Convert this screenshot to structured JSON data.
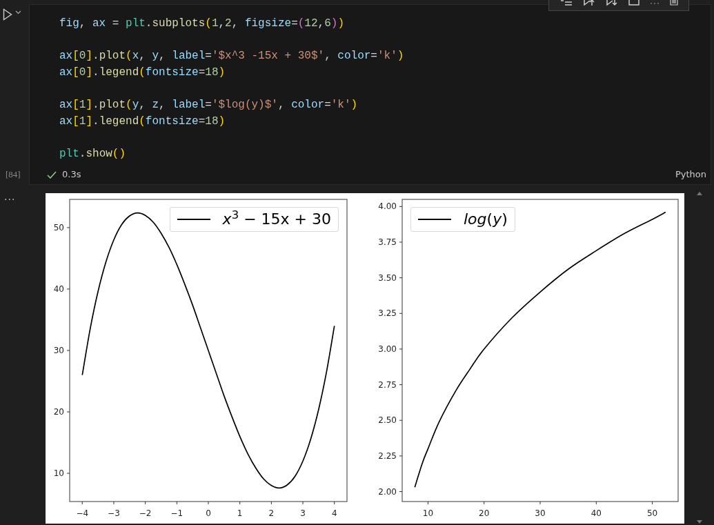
{
  "cell": {
    "execution_count": "[84]",
    "status": {
      "succeeded": true,
      "duration": "0.3s"
    },
    "language": "Python",
    "code_blocks": [
      {
        "lines": [
          [
            {
              "text": "fig",
              "kind": "var"
            },
            {
              "text": ", ",
              "kind": "punct"
            },
            {
              "text": "ax",
              "kind": "var"
            },
            {
              "text": " = ",
              "kind": "punct"
            },
            {
              "text": "plt",
              "kind": "module"
            },
            {
              "text": ".",
              "kind": "punct"
            },
            {
              "text": "subplots",
              "kind": "func"
            },
            {
              "text": "(",
              "kind": "bracket1"
            },
            {
              "text": "1",
              "kind": "num"
            },
            {
              "text": ",",
              "kind": "punct"
            },
            {
              "text": "2",
              "kind": "num"
            },
            {
              "text": ", ",
              "kind": "punct"
            },
            {
              "text": "figsize",
              "kind": "var"
            },
            {
              "text": "=",
              "kind": "punct"
            },
            {
              "text": "(",
              "kind": "bracket2"
            },
            {
              "text": "12",
              "kind": "num"
            },
            {
              "text": ",",
              "kind": "punct"
            },
            {
              "text": "6",
              "kind": "num"
            },
            {
              "text": ")",
              "kind": "bracket2"
            },
            {
              "text": ")",
              "kind": "bracket1"
            }
          ]
        ]
      },
      {
        "lines": [
          [
            {
              "text": "ax",
              "kind": "var"
            },
            {
              "text": "[",
              "kind": "bracket1"
            },
            {
              "text": "0",
              "kind": "num"
            },
            {
              "text": "]",
              "kind": "bracket1"
            },
            {
              "text": ".",
              "kind": "punct"
            },
            {
              "text": "plot",
              "kind": "func"
            },
            {
              "text": "(",
              "kind": "bracket1"
            },
            {
              "text": "x",
              "kind": "var"
            },
            {
              "text": ", ",
              "kind": "punct"
            },
            {
              "text": "y",
              "kind": "var"
            },
            {
              "text": ", ",
              "kind": "punct"
            },
            {
              "text": "label",
              "kind": "var"
            },
            {
              "text": "=",
              "kind": "punct"
            },
            {
              "text": "'$x^3 -15x + 30$'",
              "kind": "str"
            },
            {
              "text": ", ",
              "kind": "punct"
            },
            {
              "text": "color",
              "kind": "var"
            },
            {
              "text": "=",
              "kind": "punct"
            },
            {
              "text": "'k'",
              "kind": "str"
            },
            {
              "text": ")",
              "kind": "bracket1"
            }
          ],
          [
            {
              "text": "ax",
              "kind": "var"
            },
            {
              "text": "[",
              "kind": "bracket1"
            },
            {
              "text": "0",
              "kind": "num"
            },
            {
              "text": "]",
              "kind": "bracket1"
            },
            {
              "text": ".",
              "kind": "punct"
            },
            {
              "text": "legend",
              "kind": "func"
            },
            {
              "text": "(",
              "kind": "bracket1"
            },
            {
              "text": "fontsize",
              "kind": "var"
            },
            {
              "text": "=",
              "kind": "punct"
            },
            {
              "text": "18",
              "kind": "num"
            },
            {
              "text": ")",
              "kind": "bracket1"
            }
          ]
        ]
      },
      {
        "lines": [
          [
            {
              "text": "ax",
              "kind": "var"
            },
            {
              "text": "[",
              "kind": "bracket1"
            },
            {
              "text": "1",
              "kind": "num"
            },
            {
              "text": "]",
              "kind": "bracket1"
            },
            {
              "text": ".",
              "kind": "punct"
            },
            {
              "text": "plot",
              "kind": "func"
            },
            {
              "text": "(",
              "kind": "bracket1"
            },
            {
              "text": "y",
              "kind": "var"
            },
            {
              "text": ", ",
              "kind": "punct"
            },
            {
              "text": "z",
              "kind": "var"
            },
            {
              "text": ", ",
              "kind": "punct"
            },
            {
              "text": "label",
              "kind": "var"
            },
            {
              "text": "=",
              "kind": "punct"
            },
            {
              "text": "'$log(y)$'",
              "kind": "str"
            },
            {
              "text": ", ",
              "kind": "punct"
            },
            {
              "text": "color",
              "kind": "var"
            },
            {
              "text": "=",
              "kind": "punct"
            },
            {
              "text": "'k'",
              "kind": "str"
            },
            {
              "text": ")",
              "kind": "bracket1"
            }
          ],
          [
            {
              "text": "ax",
              "kind": "var"
            },
            {
              "text": "[",
              "kind": "bracket1"
            },
            {
              "text": "1",
              "kind": "num"
            },
            {
              "text": "]",
              "kind": "bracket1"
            },
            {
              "text": ".",
              "kind": "punct"
            },
            {
              "text": "legend",
              "kind": "func"
            },
            {
              "text": "(",
              "kind": "bracket1"
            },
            {
              "text": "fontsize",
              "kind": "var"
            },
            {
              "text": "=",
              "kind": "punct"
            },
            {
              "text": "18",
              "kind": "num"
            },
            {
              "text": ")",
              "kind": "bracket1"
            }
          ]
        ]
      },
      {
        "lines": [
          [
            {
              "text": "plt",
              "kind": "module"
            },
            {
              "text": ".",
              "kind": "punct"
            },
            {
              "text": "show",
              "kind": "func"
            },
            {
              "text": "(",
              "kind": "bracket1"
            },
            {
              "text": ")",
              "kind": "bracket1"
            }
          ]
        ]
      }
    ]
  },
  "output": {
    "more": "...",
    "figures": [
      {
        "chart_data": {
          "type": "line",
          "x": [
            -4,
            -3.75,
            -3.5,
            -3.25,
            -3,
            -2.75,
            -2.5,
            -2.25,
            -2,
            -1.75,
            -1.5,
            -1.25,
            -1,
            -0.75,
            -0.5,
            -0.25,
            0,
            0.25,
            0.5,
            0.75,
            1,
            1.25,
            1.5,
            1.75,
            2,
            2.25,
            2.5,
            2.75,
            3,
            3.25,
            3.5,
            3.75,
            4
          ],
          "series": [
            {
              "name": "*x*$^{3}$ − 15x + 30",
              "color": "#000000",
              "values": [
                26,
                33.5,
                39.6,
                44.4,
                48,
                50.5,
                51.9,
                52.4,
                52,
                50.9,
                49.1,
                46.8,
                44,
                40.8,
                37.4,
                33.7,
                30,
                26.3,
                22.6,
                19.2,
                16,
                13.2,
                10.9,
                9.1,
                8,
                7.6,
                8.1,
                9.5,
                12,
                15.6,
                20.4,
                26.5,
                34
              ]
            }
          ],
          "xlim": [
            -4.4,
            4.4
          ],
          "ylim": [
            5.4,
            54.6
          ],
          "xticks": [
            {
              "value": -4,
              "label": "−4"
            },
            {
              "value": -3,
              "label": "−3"
            },
            {
              "value": -2,
              "label": "−2"
            },
            {
              "value": -1,
              "label": "−1"
            },
            {
              "value": 0,
              "label": "0"
            },
            {
              "value": 1,
              "label": "1"
            },
            {
              "value": 2,
              "label": "2"
            },
            {
              "value": 3,
              "label": "3"
            },
            {
              "value": 4,
              "label": "4"
            }
          ],
          "yticks": [
            {
              "value": 10,
              "label": "10"
            },
            {
              "value": 20,
              "label": "20"
            },
            {
              "value": 30,
              "label": "30"
            },
            {
              "value": 40,
              "label": "40"
            },
            {
              "value": 50,
              "label": "50"
            }
          ]
        }
      },
      {
        "chart_data": {
          "type": "line",
          "x": [
            7.64,
            9,
            10,
            12,
            15,
            17.5,
            20,
            25,
            30,
            35,
            40,
            45,
            50,
            52.36
          ],
          "series": [
            {
              "name": "*log*(*y*)",
              "color": "#000000",
              "values": [
                2.03,
                2.2,
                2.3,
                2.49,
                2.71,
                2.86,
                3,
                3.22,
                3.4,
                3.56,
                3.69,
                3.81,
                3.91,
                3.96
              ]
            }
          ],
          "xlim": [
            5.4,
            54.6
          ],
          "ylim": [
            1.93,
            4.05
          ],
          "xticks": [
            {
              "value": 10,
              "label": "10"
            },
            {
              "value": 20,
              "label": "20"
            },
            {
              "value": 30,
              "label": "30"
            },
            {
              "value": 40,
              "label": "40"
            },
            {
              "value": 50,
              "label": "50"
            }
          ],
          "yticks": [
            {
              "value": 2,
              "label": "2.00"
            },
            {
              "value": 2.25,
              "label": "2.25"
            },
            {
              "value": 2.5,
              "label": "2.50"
            },
            {
              "value": 2.75,
              "label": "2.75"
            },
            {
              "value": 3,
              "label": "3.00"
            },
            {
              "value": 3.25,
              "label": "3.25"
            },
            {
              "value": 3.5,
              "label": "3.50"
            },
            {
              "value": 3.75,
              "label": "3.75"
            },
            {
              "value": 4,
              "label": "4.00"
            }
          ]
        }
      }
    ]
  }
}
